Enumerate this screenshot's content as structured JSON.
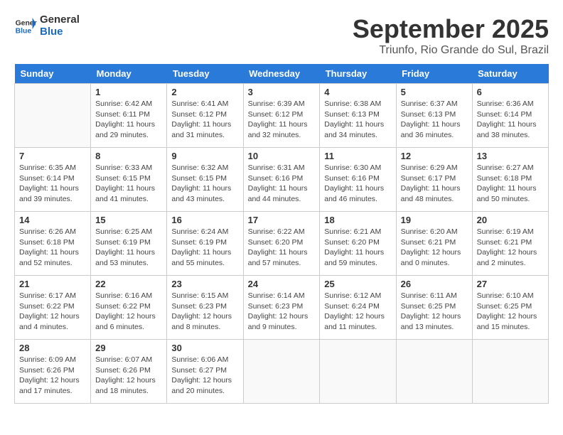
{
  "header": {
    "logo_general": "General",
    "logo_blue": "Blue",
    "month": "September 2025",
    "location": "Triunfo, Rio Grande do Sul, Brazil"
  },
  "weekdays": [
    "Sunday",
    "Monday",
    "Tuesday",
    "Wednesday",
    "Thursday",
    "Friday",
    "Saturday"
  ],
  "weeks": [
    [
      {
        "day": "",
        "info": ""
      },
      {
        "day": "1",
        "info": "Sunrise: 6:42 AM\nSunset: 6:11 PM\nDaylight: 11 hours\nand 29 minutes."
      },
      {
        "day": "2",
        "info": "Sunrise: 6:41 AM\nSunset: 6:12 PM\nDaylight: 11 hours\nand 31 minutes."
      },
      {
        "day": "3",
        "info": "Sunrise: 6:39 AM\nSunset: 6:12 PM\nDaylight: 11 hours\nand 32 minutes."
      },
      {
        "day": "4",
        "info": "Sunrise: 6:38 AM\nSunset: 6:13 PM\nDaylight: 11 hours\nand 34 minutes."
      },
      {
        "day": "5",
        "info": "Sunrise: 6:37 AM\nSunset: 6:13 PM\nDaylight: 11 hours\nand 36 minutes."
      },
      {
        "day": "6",
        "info": "Sunrise: 6:36 AM\nSunset: 6:14 PM\nDaylight: 11 hours\nand 38 minutes."
      }
    ],
    [
      {
        "day": "7",
        "info": "Sunrise: 6:35 AM\nSunset: 6:14 PM\nDaylight: 11 hours\nand 39 minutes."
      },
      {
        "day": "8",
        "info": "Sunrise: 6:33 AM\nSunset: 6:15 PM\nDaylight: 11 hours\nand 41 minutes."
      },
      {
        "day": "9",
        "info": "Sunrise: 6:32 AM\nSunset: 6:15 PM\nDaylight: 11 hours\nand 43 minutes."
      },
      {
        "day": "10",
        "info": "Sunrise: 6:31 AM\nSunset: 6:16 PM\nDaylight: 11 hours\nand 44 minutes."
      },
      {
        "day": "11",
        "info": "Sunrise: 6:30 AM\nSunset: 6:16 PM\nDaylight: 11 hours\nand 46 minutes."
      },
      {
        "day": "12",
        "info": "Sunrise: 6:29 AM\nSunset: 6:17 PM\nDaylight: 11 hours\nand 48 minutes."
      },
      {
        "day": "13",
        "info": "Sunrise: 6:27 AM\nSunset: 6:18 PM\nDaylight: 11 hours\nand 50 minutes."
      }
    ],
    [
      {
        "day": "14",
        "info": "Sunrise: 6:26 AM\nSunset: 6:18 PM\nDaylight: 11 hours\nand 52 minutes."
      },
      {
        "day": "15",
        "info": "Sunrise: 6:25 AM\nSunset: 6:19 PM\nDaylight: 11 hours\nand 53 minutes."
      },
      {
        "day": "16",
        "info": "Sunrise: 6:24 AM\nSunset: 6:19 PM\nDaylight: 11 hours\nand 55 minutes."
      },
      {
        "day": "17",
        "info": "Sunrise: 6:22 AM\nSunset: 6:20 PM\nDaylight: 11 hours\nand 57 minutes."
      },
      {
        "day": "18",
        "info": "Sunrise: 6:21 AM\nSunset: 6:20 PM\nDaylight: 11 hours\nand 59 minutes."
      },
      {
        "day": "19",
        "info": "Sunrise: 6:20 AM\nSunset: 6:21 PM\nDaylight: 12 hours\nand 0 minutes."
      },
      {
        "day": "20",
        "info": "Sunrise: 6:19 AM\nSunset: 6:21 PM\nDaylight: 12 hours\nand 2 minutes."
      }
    ],
    [
      {
        "day": "21",
        "info": "Sunrise: 6:17 AM\nSunset: 6:22 PM\nDaylight: 12 hours\nand 4 minutes."
      },
      {
        "day": "22",
        "info": "Sunrise: 6:16 AM\nSunset: 6:22 PM\nDaylight: 12 hours\nand 6 minutes."
      },
      {
        "day": "23",
        "info": "Sunrise: 6:15 AM\nSunset: 6:23 PM\nDaylight: 12 hours\nand 8 minutes."
      },
      {
        "day": "24",
        "info": "Sunrise: 6:14 AM\nSunset: 6:23 PM\nDaylight: 12 hours\nand 9 minutes."
      },
      {
        "day": "25",
        "info": "Sunrise: 6:12 AM\nSunset: 6:24 PM\nDaylight: 12 hours\nand 11 minutes."
      },
      {
        "day": "26",
        "info": "Sunrise: 6:11 AM\nSunset: 6:25 PM\nDaylight: 12 hours\nand 13 minutes."
      },
      {
        "day": "27",
        "info": "Sunrise: 6:10 AM\nSunset: 6:25 PM\nDaylight: 12 hours\nand 15 minutes."
      }
    ],
    [
      {
        "day": "28",
        "info": "Sunrise: 6:09 AM\nSunset: 6:26 PM\nDaylight: 12 hours\nand 17 minutes."
      },
      {
        "day": "29",
        "info": "Sunrise: 6:07 AM\nSunset: 6:26 PM\nDaylight: 12 hours\nand 18 minutes."
      },
      {
        "day": "30",
        "info": "Sunrise: 6:06 AM\nSunset: 6:27 PM\nDaylight: 12 hours\nand 20 minutes."
      },
      {
        "day": "",
        "info": ""
      },
      {
        "day": "",
        "info": ""
      },
      {
        "day": "",
        "info": ""
      },
      {
        "day": "",
        "info": ""
      }
    ]
  ]
}
